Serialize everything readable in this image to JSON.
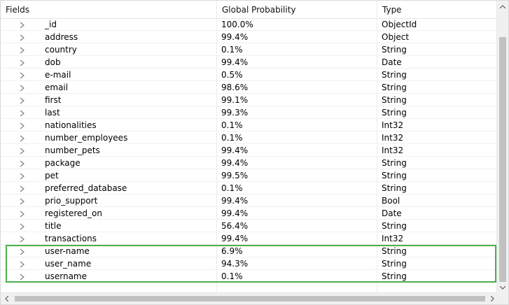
{
  "columns": {
    "fields": "Fields",
    "probability": "Global Probability",
    "type": "Type"
  },
  "rows": [
    {
      "field": "_id",
      "probability": "100.0%",
      "type": "ObjectId"
    },
    {
      "field": "address",
      "probability": "99.4%",
      "type": "Object"
    },
    {
      "field": "country",
      "probability": "0.1%",
      "type": "String"
    },
    {
      "field": "dob",
      "probability": "99.4%",
      "type": "Date"
    },
    {
      "field": "e-mail",
      "probability": "0.5%",
      "type": "String"
    },
    {
      "field": "email",
      "probability": "98.6%",
      "type": "String"
    },
    {
      "field": "first",
      "probability": "99.1%",
      "type": "String"
    },
    {
      "field": "last",
      "probability": "99.3%",
      "type": "String"
    },
    {
      "field": "nationalities",
      "probability": "0.1%",
      "type": "Int32"
    },
    {
      "field": "number_employees",
      "probability": "0.1%",
      "type": "Int32"
    },
    {
      "field": "number_pets",
      "probability": "99.4%",
      "type": "Int32"
    },
    {
      "field": "package",
      "probability": "99.4%",
      "type": "String"
    },
    {
      "field": "pet",
      "probability": "99.5%",
      "type": "String"
    },
    {
      "field": "preferred_database",
      "probability": "0.1%",
      "type": "String"
    },
    {
      "field": "prio_support",
      "probability": "99.4%",
      "type": "Bool"
    },
    {
      "field": "registered_on",
      "probability": "99.4%",
      "type": "Date"
    },
    {
      "field": "title",
      "probability": "56.4%",
      "type": "String"
    },
    {
      "field": "transactions",
      "probability": "99.4%",
      "type": "Int32"
    },
    {
      "field": "user-name",
      "probability": "6.9%",
      "type": "String"
    },
    {
      "field": "user_name",
      "probability": "94.3%",
      "type": "String"
    },
    {
      "field": "username",
      "probability": "0.1%",
      "type": "String"
    }
  ],
  "colors": {
    "highlight": "#4caf50",
    "scroll_thumb": "#c1c1c1",
    "chevron": "#808080"
  },
  "icons": {
    "expand": "chevron-right-icon",
    "scroll_up": "arrow-up-icon",
    "scroll_down": "arrow-down-icon",
    "scroll_left": "arrow-left-icon",
    "scroll_right": "arrow-right-icon"
  }
}
